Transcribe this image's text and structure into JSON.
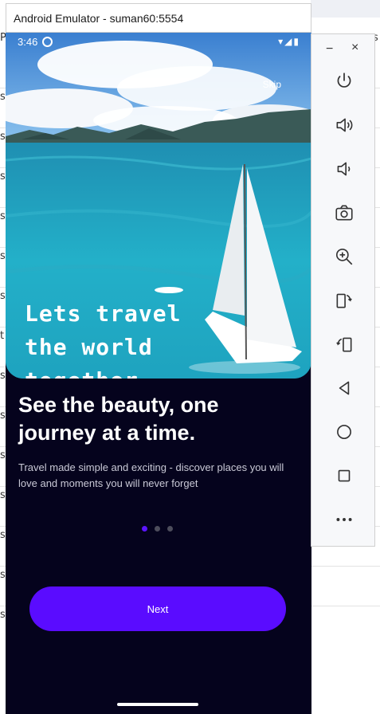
{
  "background": {
    "letters": [
      "s",
      "s",
      "s",
      "s",
      "s",
      "s",
      "t",
      "s",
      "s",
      "s",
      "s",
      "s",
      "s",
      "s"
    ],
    "corner_text": "Pe",
    "corner_right": "s"
  },
  "emulator": {
    "title": "Android Emulator - suman60:5554"
  },
  "status_bar": {
    "time": "3:46",
    "icons": "▾◢▮"
  },
  "hero": {
    "skip_label": "Skip",
    "text_lines": [
      "Lets travel",
      "the world",
      "together"
    ]
  },
  "content": {
    "headline": "See the beauty, one journey at a time.",
    "subtitle": "Travel made simple and exciting - discover places you will love and moments you will never forget",
    "pagination": {
      "total": 3,
      "active": 0
    }
  },
  "next_button": {
    "label": "Next"
  },
  "toolbar": {
    "minimize": "−",
    "close": "×",
    "items": [
      {
        "icon": "power-icon"
      },
      {
        "icon": "volume-up-icon"
      },
      {
        "icon": "volume-down-icon"
      },
      {
        "icon": "camera-icon"
      },
      {
        "icon": "zoom-in-icon"
      },
      {
        "icon": "rotate-right-icon"
      },
      {
        "icon": "rotate-left-icon"
      },
      {
        "icon": "back-icon"
      },
      {
        "icon": "home-icon"
      },
      {
        "icon": "overview-icon"
      },
      {
        "icon": "more-icon"
      }
    ]
  },
  "colors": {
    "screen_bg": "#05031d",
    "accent": "#5a0cff",
    "sea": "#2fa6c4"
  }
}
